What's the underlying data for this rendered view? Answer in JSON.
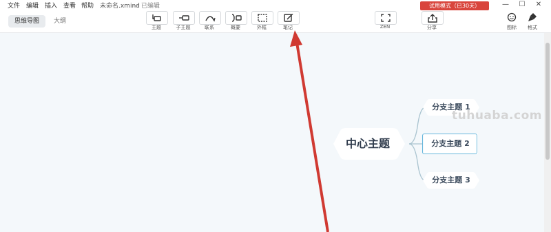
{
  "menubar": {
    "items": [
      "文件",
      "编辑",
      "插入",
      "查看",
      "帮助"
    ],
    "doc_title": "未命名.xmind",
    "doc_status": "— 已编辑",
    "trial_badge": "试用模式（已30天）",
    "window_controls": [
      "—",
      "☐",
      "✕"
    ]
  },
  "view_tabs": {
    "active": "思维导图",
    "other": "大纲"
  },
  "toolbar": {
    "tools": [
      {
        "label": "主题",
        "icon": "topic-icon"
      },
      {
        "label": "子主题",
        "icon": "subtopic-icon"
      },
      {
        "label": "联系",
        "icon": "relationship-icon"
      },
      {
        "label": "概要",
        "icon": "summary-icon"
      },
      {
        "label": "外框",
        "icon": "boundary-icon"
      },
      {
        "label": "笔记",
        "icon": "notes-icon"
      },
      {
        "label": "ZEN",
        "icon": "zen-icon"
      },
      {
        "label": "分享",
        "icon": "share-icon"
      },
      {
        "label": "图标",
        "icon": "emoji-icon"
      },
      {
        "label": "格式",
        "icon": "format-brush-icon"
      }
    ]
  },
  "mindmap": {
    "central_topic": "中心主题",
    "branches": [
      "分支主题 1",
      "分支主题 2",
      "分支主题 3"
    ],
    "selected_branch": 2
  },
  "watermark": "tuhuaba.com",
  "colors": {
    "canvas": "#f4f8fb",
    "trial_badge": "#d9453c",
    "selection": "#66b6dc",
    "arrow": "#d03a32",
    "connector": "#a9c3cf"
  }
}
